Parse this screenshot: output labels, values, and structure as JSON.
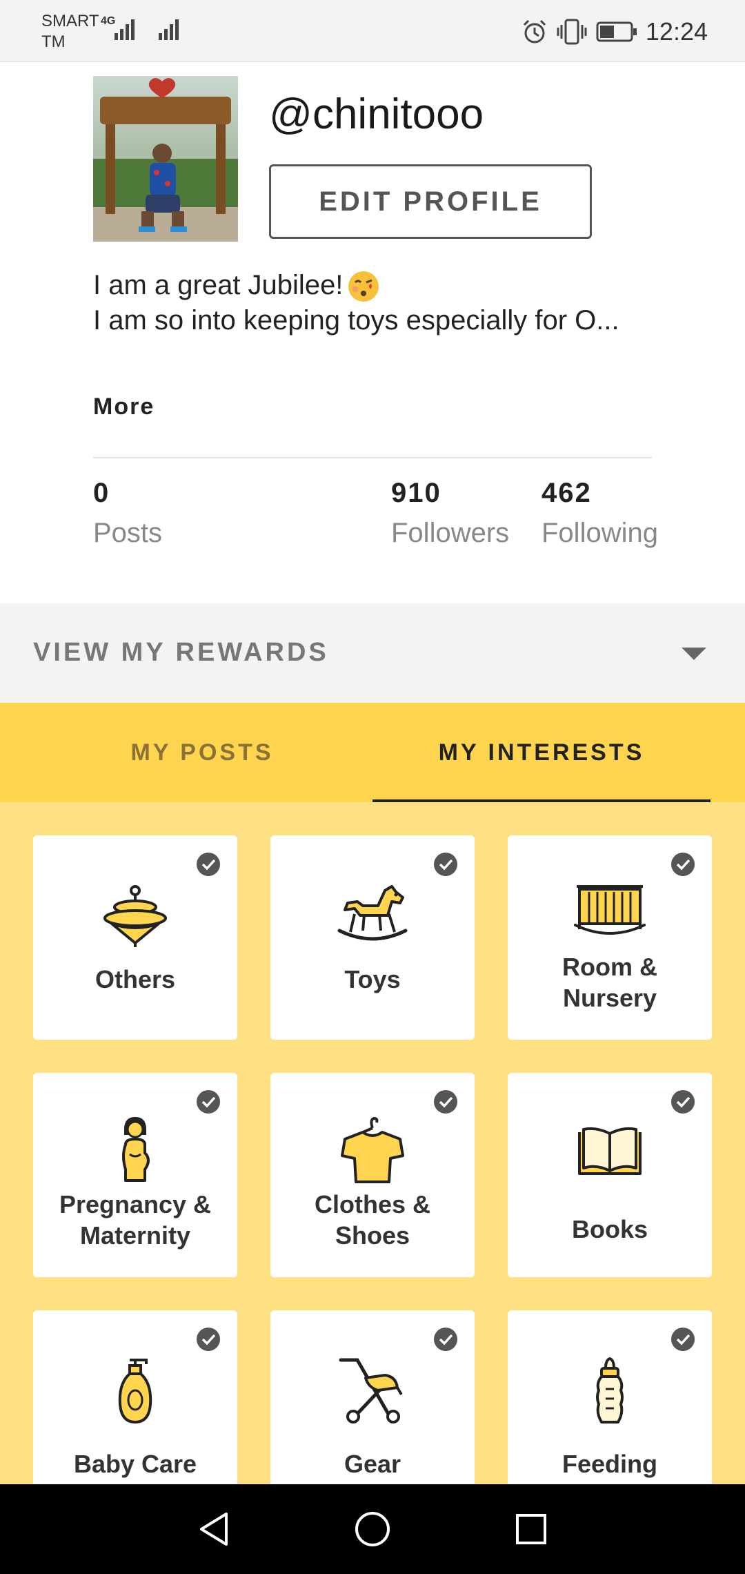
{
  "status_bar": {
    "carrier_line1": "SMART",
    "carrier_line2": "TM",
    "network": "4G",
    "time": "12:24"
  },
  "profile": {
    "username": "@chinitooo",
    "edit_button": "EDIT PROFILE",
    "bio_line1": "I am a great Jubilee!",
    "bio_line2": "I am so into keeping toys especially for O...",
    "more_label": "More",
    "stats": [
      {
        "value": "0",
        "label": "Posts"
      },
      {
        "value": "910",
        "label": "Followers"
      },
      {
        "value": "462",
        "label": "Following"
      }
    ]
  },
  "rewards": {
    "label": "VIEW MY REWARDS"
  },
  "tabs": [
    {
      "label": "MY POSTS",
      "active": false
    },
    {
      "label": "MY INTERESTS",
      "active": true
    }
  ],
  "interests": [
    {
      "label": "Others",
      "icon": "spinning-top-icon",
      "checked": true
    },
    {
      "label": "Toys",
      "icon": "rocking-horse-icon",
      "checked": true
    },
    {
      "label": "Room & Nursery",
      "icon": "crib-icon",
      "checked": true
    },
    {
      "label": "Pregnancy & Maternity",
      "icon": "pregnant-woman-icon",
      "checked": true
    },
    {
      "label": "Clothes & Shoes",
      "icon": "shirt-hanger-icon",
      "checked": true
    },
    {
      "label": "Books",
      "icon": "open-book-icon",
      "checked": true
    },
    {
      "label": "Baby Care",
      "icon": "lotion-bottle-icon",
      "checked": true
    },
    {
      "label": "Gear",
      "icon": "stroller-icon",
      "checked": true
    },
    {
      "label": "Feeding",
      "icon": "baby-bottle-icon",
      "checked": true
    }
  ],
  "colors": {
    "accent_yellow": "#ffd54f",
    "grid_background": "#ffe082",
    "icon_fill": "#ffd54f",
    "text_dark": "#222222"
  },
  "nav_bar": {
    "back": "back-icon",
    "home": "home-icon",
    "recents": "recents-icon"
  }
}
